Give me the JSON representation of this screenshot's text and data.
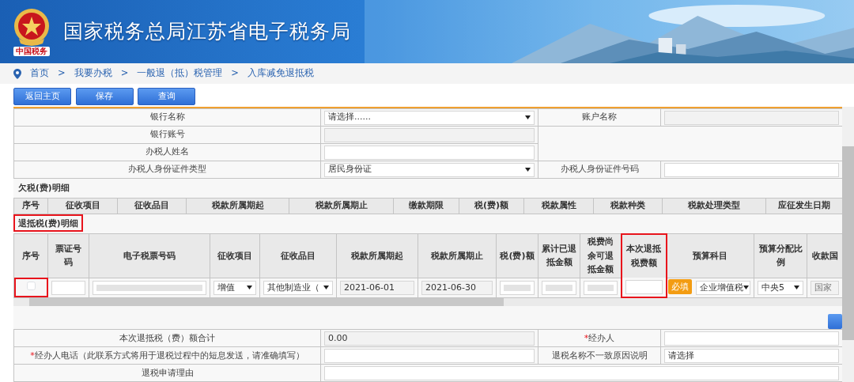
{
  "header": {
    "title": "国家税务总局江苏省电子税务局",
    "logo_caption": "中国税务"
  },
  "breadcrumb": {
    "separator": ">",
    "items": [
      "首页",
      "我要办税",
      "一般退（抵）税管理",
      "入库减免退抵税"
    ]
  },
  "toolbar": [
    {
      "label": "返回主页"
    },
    {
      "label": "保存"
    },
    {
      "label": "查询"
    }
  ],
  "bank_form": [
    {
      "cells": [
        {
          "kind": "label",
          "text": "银行名称"
        },
        {
          "kind": "select",
          "value": "请选择......"
        },
        {
          "kind": "label",
          "text": "账户名称"
        },
        {
          "kind": "readonly"
        }
      ]
    },
    {
      "cells": [
        {
          "kind": "label",
          "text": "银行账号"
        },
        {
          "kind": "readonly"
        },
        {
          "kind": "blank"
        }
      ]
    },
    {
      "cells": [
        {
          "kind": "label",
          "text": "办税人姓名"
        },
        {
          "kind": "input"
        }
      ]
    },
    {
      "cells": [
        {
          "kind": "label",
          "text": "办税人身份证件类型"
        },
        {
          "kind": "select",
          "value": "居民身份证"
        },
        {
          "kind": "label",
          "text": "办税人身份证件号码"
        },
        {
          "kind": "input"
        }
      ]
    }
  ],
  "arrears": {
    "title": "欠税(费)明细",
    "columns": [
      "序号",
      "征收项目",
      "征收品目",
      "税款所属期起",
      "税款所属期止",
      "缴款期限",
      "税(费)额",
      "税款属性",
      "税款种类",
      "税款处理类型",
      "应征发生日期"
    ]
  },
  "refund": {
    "title": "退抵税(费)明细",
    "highlighted": true,
    "columns": [
      {
        "label": "序号",
        "highlighted": false
      },
      {
        "label": "票证号码",
        "highlighted": false
      },
      {
        "label": "电子税票号码",
        "highlighted": false
      },
      {
        "label": "征收项目",
        "highlighted": false
      },
      {
        "label": "征收品目",
        "highlighted": false
      },
      {
        "label": "税款所属期起",
        "highlighted": false
      },
      {
        "label": "税款所属期止",
        "highlighted": false
      },
      {
        "label": "税(费)额",
        "highlighted": false
      },
      {
        "label": "累计已退抵金额",
        "highlighted": false
      },
      {
        "label": "税费尚余可退抵金额",
        "highlighted": false
      },
      {
        "label": "本次退抵税费额",
        "highlighted": true
      },
      {
        "label": "预算科目",
        "highlighted": false
      },
      {
        "label": "预算分配比例",
        "highlighted": false
      },
      {
        "label": "收款国",
        "highlighted": false
      }
    ],
    "rows": [
      {
        "cells": [
          {
            "kind": "checkbox",
            "checked": false,
            "highlighted": true
          },
          {
            "kind": "input"
          },
          {
            "kind": "masked"
          },
          {
            "kind": "select",
            "value": "增值"
          },
          {
            "kind": "select",
            "value": "其他制造业（"
          },
          {
            "kind": "readonly",
            "value": "2021-06-01"
          },
          {
            "kind": "readonly",
            "value": "2021-06-30"
          },
          {
            "kind": "masked"
          },
          {
            "kind": "masked"
          },
          {
            "kind": "masked"
          },
          {
            "kind": "input",
            "tooltip": "必填"
          },
          {
            "kind": "select",
            "value": "企业增值税"
          },
          {
            "kind": "select",
            "value": "中央5"
          },
          {
            "kind": "readonly",
            "placeholder": "国家"
          }
        ]
      }
    ]
  },
  "summary_form": [
    {
      "cells": [
        {
          "kind": "label",
          "text": "本次退抵税（费）额合计"
        },
        {
          "kind": "readonly",
          "value": "0.00"
        },
        {
          "kind": "label",
          "text": "经办人",
          "required_mark": "*"
        },
        {
          "kind": "input"
        }
      ]
    },
    {
      "cells": [
        {
          "kind": "label",
          "text": "经办人电话（此联系方式将用于退税过程中的短息发送，请准确填写）",
          "required_mark": "*"
        },
        {
          "kind": "input"
        },
        {
          "kind": "label",
          "text": "退税名称不一致原因说明"
        },
        {
          "kind": "input",
          "value": "请选择"
        }
      ]
    },
    {
      "cells": [
        {
          "kind": "label",
          "text": "退税申请理由"
        },
        {
          "kind": "input"
        }
      ]
    }
  ]
}
